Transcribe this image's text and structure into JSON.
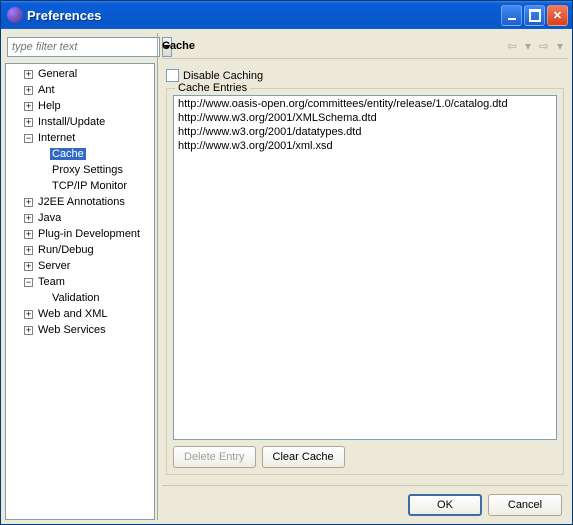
{
  "window": {
    "title": "Preferences"
  },
  "filter": {
    "placeholder": "type filter text"
  },
  "tree": [
    {
      "label": "General",
      "depth": 1,
      "expander": "+",
      "selected": false
    },
    {
      "label": "Ant",
      "depth": 1,
      "expander": "+",
      "selected": false
    },
    {
      "label": "Help",
      "depth": 1,
      "expander": "+",
      "selected": false
    },
    {
      "label": "Install/Update",
      "depth": 1,
      "expander": "+",
      "selected": false
    },
    {
      "label": "Internet",
      "depth": 1,
      "expander": "-",
      "selected": false
    },
    {
      "label": "Cache",
      "depth": 2,
      "expander": "",
      "selected": true
    },
    {
      "label": "Proxy Settings",
      "depth": 2,
      "expander": "",
      "selected": false
    },
    {
      "label": "TCP/IP Monitor",
      "depth": 2,
      "expander": "",
      "selected": false
    },
    {
      "label": "J2EE Annotations",
      "depth": 1,
      "expander": "+",
      "selected": false
    },
    {
      "label": "Java",
      "depth": 1,
      "expander": "+",
      "selected": false
    },
    {
      "label": "Plug-in Development",
      "depth": 1,
      "expander": "+",
      "selected": false
    },
    {
      "label": "Run/Debug",
      "depth": 1,
      "expander": "+",
      "selected": false
    },
    {
      "label": "Server",
      "depth": 1,
      "expander": "+",
      "selected": false
    },
    {
      "label": "Team",
      "depth": 1,
      "expander": "-",
      "selected": false
    },
    {
      "label": "Validation",
      "depth": 2,
      "expander": "",
      "selected": false
    },
    {
      "label": "Web and XML",
      "depth": 1,
      "expander": "+",
      "selected": false
    },
    {
      "label": "Web Services",
      "depth": 1,
      "expander": "+",
      "selected": false
    }
  ],
  "page": {
    "title": "Cache",
    "disable_caching_label": "Disable Caching",
    "entries_legend": "Cache Entries",
    "entries": [
      "http://www.oasis-open.org/committees/entity/release/1.0/catalog.dtd",
      "http://www.w3.org/2001/XMLSchema.dtd",
      "http://www.w3.org/2001/datatypes.dtd",
      "http://www.w3.org/2001/xml.xsd"
    ],
    "delete_entry_label": "Delete Entry",
    "clear_cache_label": "Clear Cache"
  },
  "buttons": {
    "ok": "OK",
    "cancel": "Cancel"
  }
}
